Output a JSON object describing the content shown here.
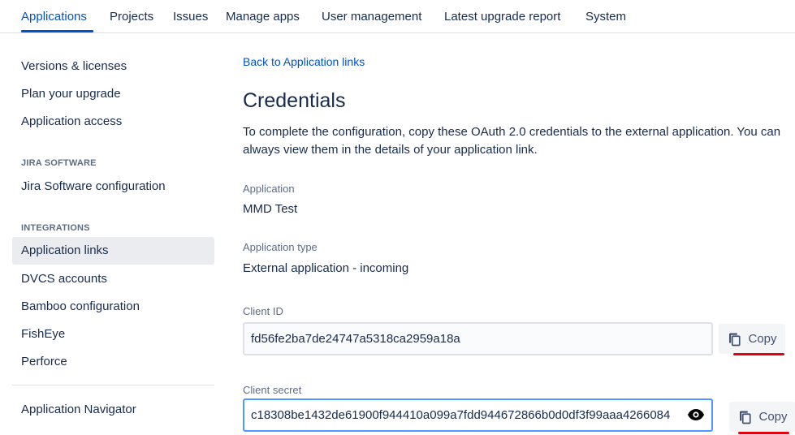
{
  "topnav": {
    "tabs": [
      {
        "label": "Applications",
        "active": true
      },
      {
        "label": "Projects",
        "active": false
      },
      {
        "label": "Issues",
        "active": false
      },
      {
        "label": "Manage apps",
        "active": false
      },
      {
        "label": "User management",
        "active": false
      },
      {
        "label": "Latest upgrade report",
        "active": false
      },
      {
        "label": "System",
        "active": false
      }
    ]
  },
  "sidebar": {
    "items_top": [
      {
        "label": "Versions & licenses"
      },
      {
        "label": "Plan your upgrade"
      },
      {
        "label": "Application access"
      }
    ],
    "section_jira": {
      "header": "JIRA SOFTWARE",
      "items": [
        {
          "label": "Jira Software configuration"
        }
      ]
    },
    "section_integrations": {
      "header": "INTEGRATIONS",
      "items": [
        {
          "label": "Application links",
          "selected": true
        },
        {
          "label": "DVCS accounts"
        },
        {
          "label": "Bamboo configuration"
        },
        {
          "label": "FishEye"
        },
        {
          "label": "Perforce"
        }
      ]
    },
    "bottom_item": {
      "label": "Application Navigator"
    }
  },
  "main": {
    "back_link": "Back to Application links",
    "title": "Credentials",
    "description": "To complete the configuration, copy these OAuth 2.0 credentials to the external application. You can always view them in the details of your application link.",
    "application": {
      "label": "Application",
      "value": "MMD Test"
    },
    "application_type": {
      "label": "Application type",
      "value": "External application - incoming"
    },
    "client_id": {
      "label": "Client ID",
      "value": "fd56fe2ba7de24747a5318ca2959a18a",
      "copy_label": "Copy"
    },
    "client_secret": {
      "label": "Client secret",
      "value": "c18308be1432de61900f944410a099a7fdd944672866b0d0df3f99aaa4266084",
      "copy_label": "Copy"
    }
  },
  "colors": {
    "link": "#0052cc",
    "text": "#172b4d",
    "muted": "#5e6c84",
    "focus_border": "#4c9aff",
    "annotation_red": "#e3000f"
  },
  "icons": [
    "eye-icon",
    "copy-icon"
  ]
}
